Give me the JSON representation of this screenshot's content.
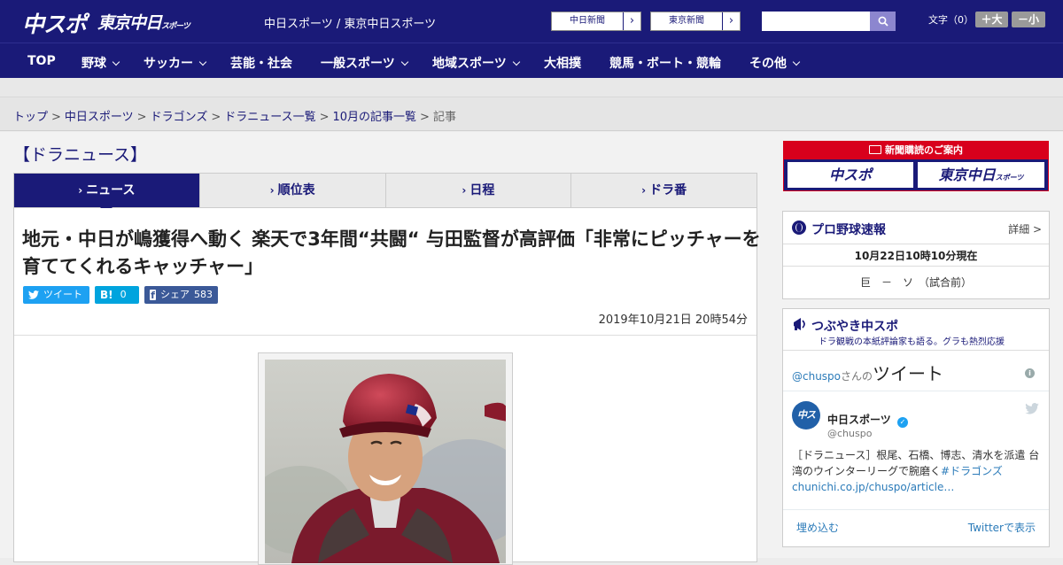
{
  "header": {
    "logo_chuspo": "中スポ",
    "logo_tokyo": "東京中日",
    "logo_tokyo_small": "スポーツ",
    "site_name": "中日スポーツ / 東京中日スポーツ",
    "newspaper_buttons": [
      "中日新聞",
      "東京新聞"
    ],
    "search_placeholder": "",
    "font_label": "文字（0）",
    "font_bigger": "＋大",
    "font_smaller": "－小"
  },
  "nav": {
    "items": [
      {
        "label": "TOP",
        "has_dropdown": false
      },
      {
        "label": "野球",
        "has_dropdown": true
      },
      {
        "label": "サッカー",
        "has_dropdown": true
      },
      {
        "label": "芸能・社会",
        "has_dropdown": false
      },
      {
        "label": "一般スポーツ",
        "has_dropdown": true
      },
      {
        "label": "地域スポーツ",
        "has_dropdown": true
      },
      {
        "label": "大相撲",
        "has_dropdown": false
      },
      {
        "label": "競馬・ボート・競輪",
        "has_dropdown": false
      },
      {
        "label": "その他",
        "has_dropdown": true
      }
    ]
  },
  "breadcrumb": {
    "items": [
      "トップ",
      "中日スポーツ",
      "ドラゴンズ",
      "ドラニュース一覧",
      "10月の記事一覧",
      "記事"
    ],
    "separator": ">"
  },
  "section_title": "【ドラニュース】",
  "tabs": [
    {
      "label": "ニュース",
      "active": true
    },
    {
      "label": "順位表",
      "active": false
    },
    {
      "label": "日程",
      "active": false
    },
    {
      "label": "ドラ番",
      "active": false
    }
  ],
  "article": {
    "headline": "地元・中日が嶋獲得へ動く 楽天で3年間“共闘“ 与田監督が高評価「非常にピッチャーを育ててくれるキャッチャー」",
    "share": {
      "tweet_label": "ツイート",
      "hatena_label": "B!",
      "hatena_count": "0",
      "facebook_label": "シェア",
      "facebook_count": "583"
    },
    "datetime": "2019年10月21日 20時54分"
  },
  "sidebar": {
    "subscribe": {
      "title": "新聞購読のご案内",
      "logo_chuspo": "中スポ",
      "logo_tokyo": "東京中日",
      "logo_tokyo_small": "スポーツ"
    },
    "baseball": {
      "title": "プロ野球速報",
      "detail": "詳細 >",
      "as_of": "10月22日10時10分現在",
      "score": "巨　－　ソ　（試合前）"
    },
    "tweets": {
      "title": "つぶやき中スポ",
      "subtitle": "ドラ観戦の本紙評論家も語る。グラも熱烈応援",
      "handle_prefix": "@chuspo",
      "handle_suffix": "さんの",
      "tweet_word": "ツイート",
      "author": "中日スポーツ",
      "author_handle": "@chuspo",
      "text_plain": "［ドラニュース］根尾、石橋、博志、清水を派遣 台湾のウインターリーグで腕磨く",
      "text_link": "#ドラゴンズchunichi.co.jp/chuspo/article…",
      "embed_label": "埋め込む",
      "view_on_twitter": "Twitterで表示"
    }
  },
  "colors": {
    "brand_navy": "#1a1a78",
    "subscribe_red": "#d8001c",
    "twitter_blue": "#1da1f2",
    "hatena_blue": "#00a4de",
    "facebook_blue": "#3b5998",
    "search_purple": "#8c86cf"
  }
}
